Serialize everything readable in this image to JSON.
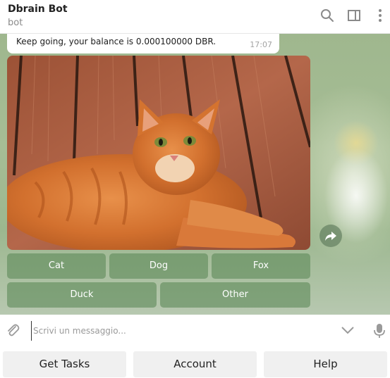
{
  "header": {
    "title": "Dbrain Bot",
    "subtitle": "bot",
    "icons": [
      "search-icon",
      "sidebar-toggle-icon",
      "more-vertical-icon"
    ]
  },
  "message": {
    "text": "Keep going, your balance is 0.000100000 DBR.",
    "time": "17:07"
  },
  "photo": {
    "subject": "orange tabby cat lying on wooden planks"
  },
  "inline_keyboard": {
    "row1": [
      "Cat",
      "Dog",
      "Fox"
    ],
    "row2": [
      "Duck",
      "Other"
    ]
  },
  "composer": {
    "placeholder": "Scrivi un messaggio...",
    "value": ""
  },
  "reply_keyboard": [
    "Get Tasks",
    "Account",
    "Help"
  ],
  "colors": {
    "inline_button": "#608a5a",
    "chat_bg": "#a6bd95",
    "accent_icon": "#8a8a8a"
  }
}
